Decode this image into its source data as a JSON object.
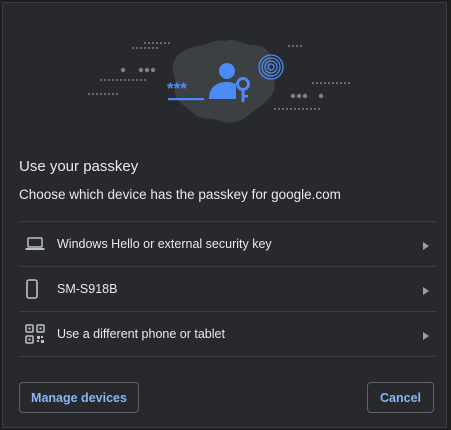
{
  "dialog": {
    "title": "Use your passkey",
    "subtitle": "Choose which device has the passkey for google.com",
    "options": [
      {
        "label": "Windows Hello or external security key",
        "icon": "laptop-icon"
      },
      {
        "label": "SM-S918B",
        "icon": "phone-icon"
      },
      {
        "label": "Use a different phone or tablet",
        "icon": "qr-code-icon"
      }
    ],
    "manage_label": "Manage devices",
    "cancel_label": "Cancel",
    "illustration_asterisks": "***"
  },
  "colors": {
    "background": "#28292c",
    "text": "#e8eaed",
    "accent": "#8ab4f8",
    "blob": "#3c4043",
    "illustration_blue": "#4c8bf5"
  }
}
